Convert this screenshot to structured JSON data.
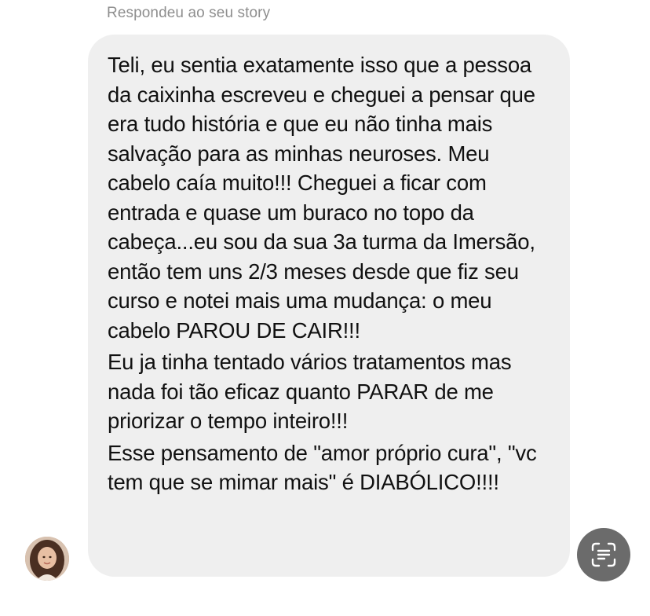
{
  "header": {
    "reply_label": "Respondeu ao seu story"
  },
  "message": {
    "paragraphs": [
      "Teli, eu sentia exatamente isso que a pessoa da caixinha escreveu e cheguei a pensar que era tudo história e que eu não tinha mais salvação para as minhas neuroses. Meu cabelo caía muito!!! Cheguei a ficar com entrada e quase um buraco no topo da cabeça...eu sou da sua 3a turma da Imersão, então tem uns 2/3 meses desde que fiz seu curso e notei mais uma mudança: o meu cabelo PAROU DE CAIR!!!",
      "Eu ja tinha tentado vários tratamentos mas nada foi tão eficaz quanto PARAR de me priorizar o tempo inteiro!!!",
      "Esse pensamento de \"amor próprio cura\", \"vc tem que se mimar mais\" é DIABÓLICO!!!!"
    ]
  },
  "sender": {
    "avatar_icon": "profile-photo"
  },
  "actions": {
    "scan_icon": "text-scan-icon"
  },
  "colors": {
    "bubble": "#efefef",
    "label": "#8e8e8e",
    "text": "#111111",
    "scan_button": "#6b6b6b"
  }
}
